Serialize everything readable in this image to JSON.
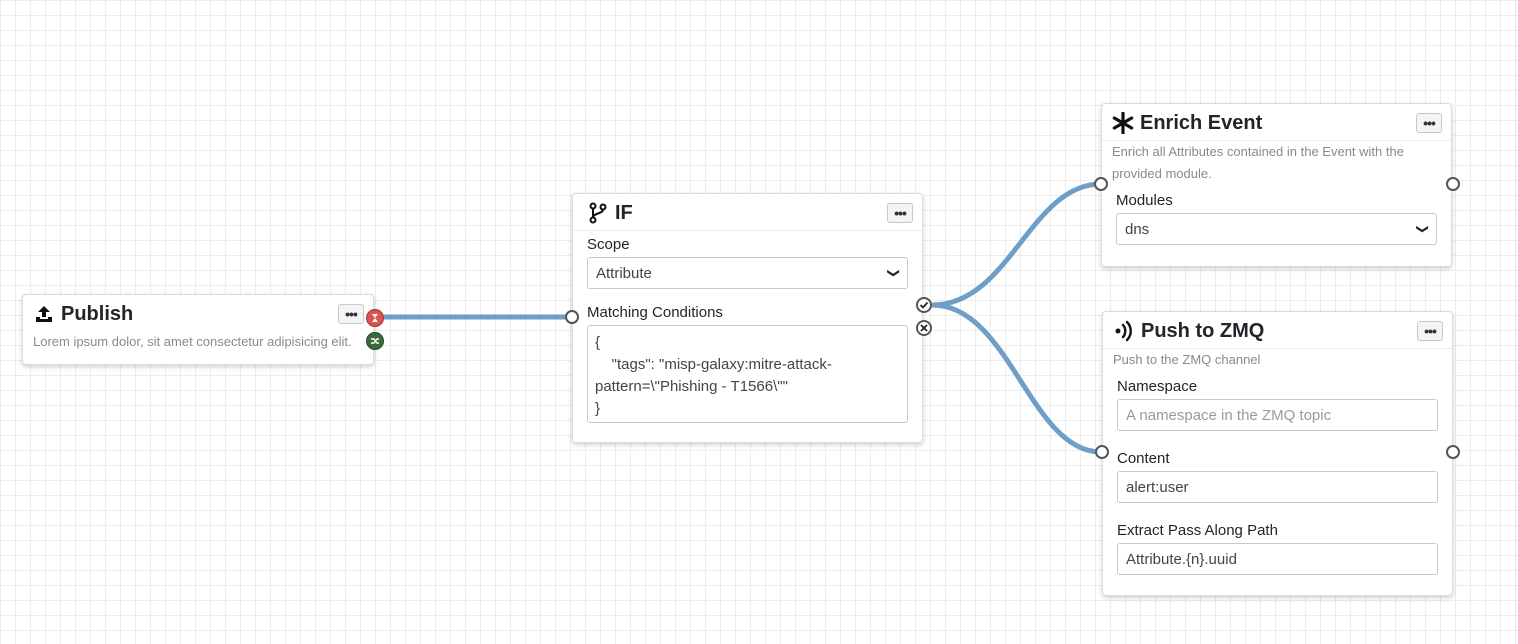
{
  "publish": {
    "title": "Publish",
    "icon": "upload-icon",
    "description": "Lorem ipsum dolor, sit amet consectetur adipisicing elit.",
    "menu_label": "•••",
    "status_colors": {
      "error": "#d9534f",
      "success": "#2e7d32"
    }
  },
  "if_node": {
    "title": "IF",
    "icon": "code-branch-icon",
    "menu_label": "•••",
    "scope_label": "Scope",
    "scope_value": "Attribute",
    "conditions_label": "Matching Conditions",
    "conditions_value": "{\n    \"tags\": \"misp-galaxy:mitre-attack-\npattern=\\\"Phishing - T1566\\\"\"\n}"
  },
  "enrich": {
    "title": "Enrich Event",
    "icon": "asterisk-icon",
    "menu_label": "•••",
    "description": "Enrich all Attributes contained in the Event with the provided module.",
    "modules_label": "Modules",
    "modules_value": "dns"
  },
  "zmq": {
    "title": "Push to ZMQ",
    "icon": "broadcast-icon",
    "menu_label": "•••",
    "description": "Push to the ZMQ channel",
    "namespace_label": "Namespace",
    "namespace_placeholder": "A namespace in the ZMQ topic",
    "content_label": "Content",
    "content_value": "alert:user",
    "extract_label": "Extract Pass Along Path",
    "extract_value": "Attribute.{n}.uuid"
  },
  "colors": {
    "connection": "#6f9ec7",
    "port_border": "#555555"
  }
}
